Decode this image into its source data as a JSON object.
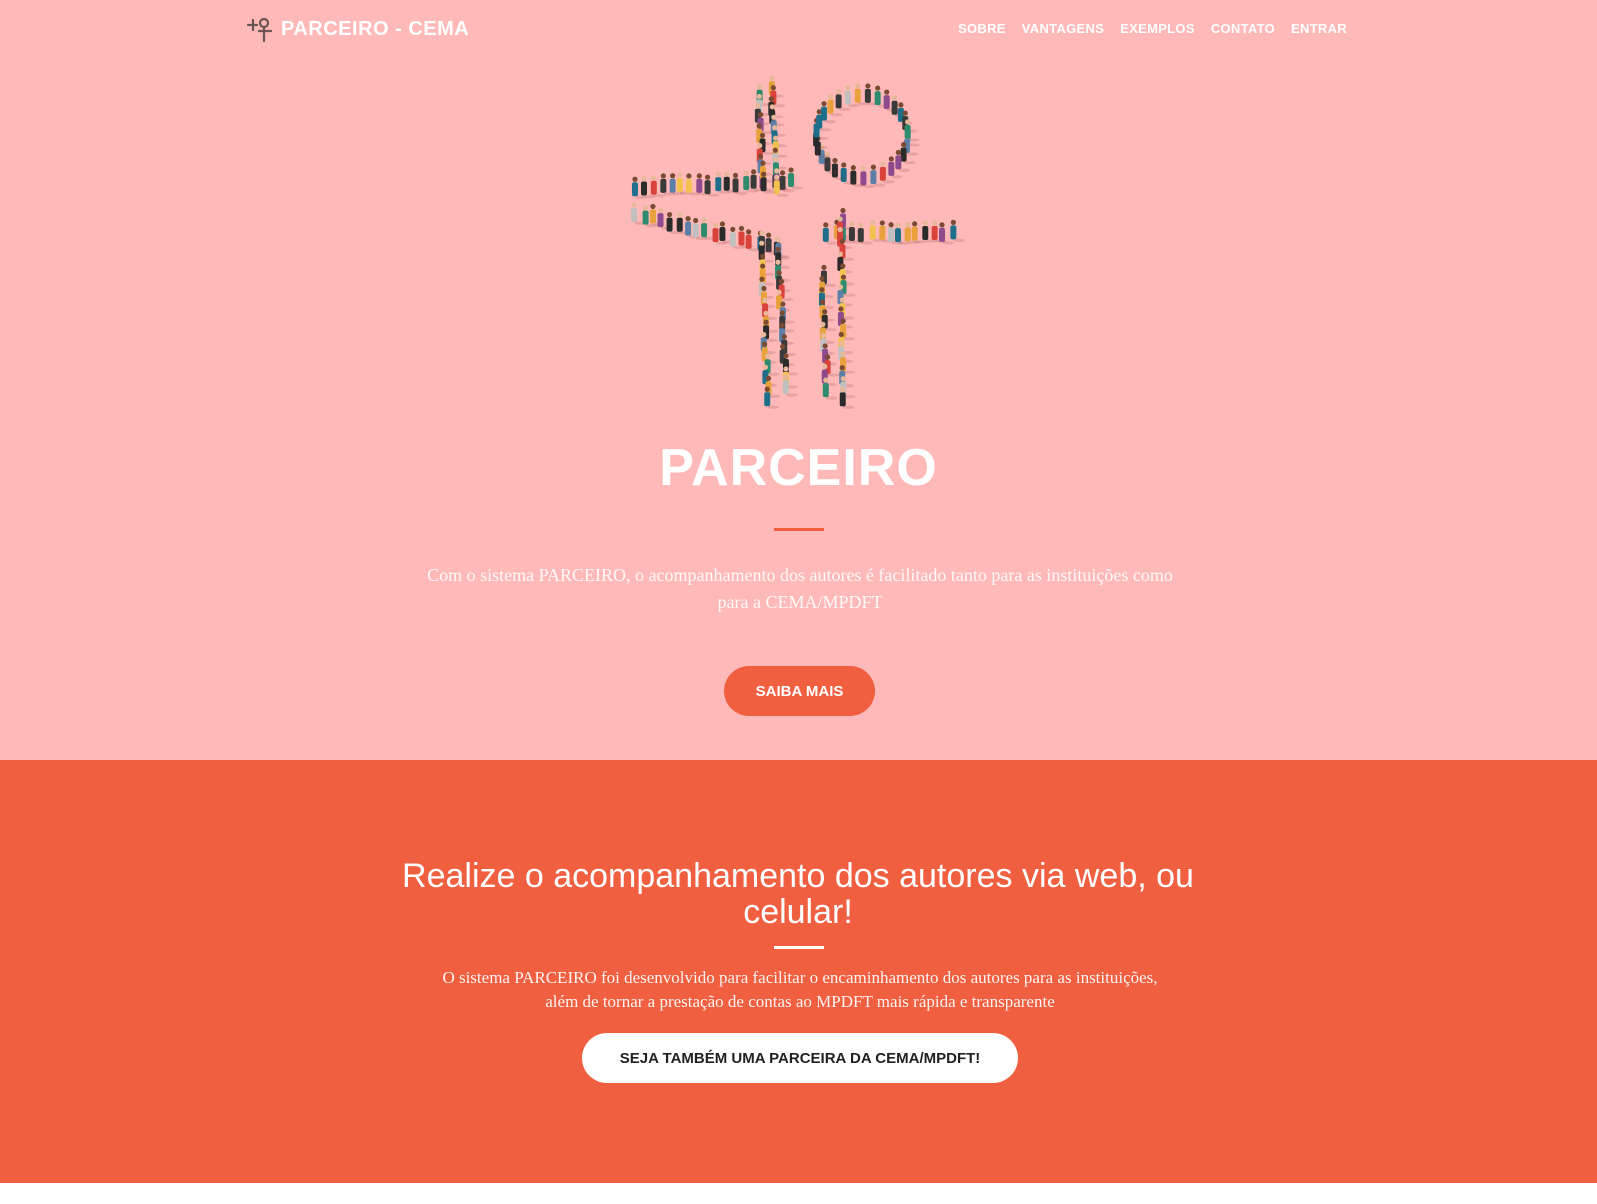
{
  "navbar": {
    "brand": "PARCEIRO - CEMA",
    "brand_icon": "plus-people-logo-icon",
    "links": [
      {
        "label": "SOBRE"
      },
      {
        "label": "VANTAGENS"
      },
      {
        "label": "EXEMPLOS"
      },
      {
        "label": "CONTATO"
      },
      {
        "label": "ENTRAR"
      }
    ]
  },
  "hero": {
    "graphic_icon": "crowd-forming-plus-signs-illustration",
    "title": "PARCEIRO",
    "text": "Com o sistema PARCEIRO, o acompanhamento dos autores é facilitado tanto para as instituições como para a CEMA/MPDFT",
    "button_label": "SAIBA MAIS"
  },
  "band": {
    "title": "Realize o acompanhamento dos autores via web, ou celular!",
    "text": "O sistema PARCEIRO foi desenvolvido para facilitar o encaminhamento dos autores para as instituições, além de tornar a prestação de contas ao MPDFT mais rápida e transparente",
    "button_label": "SEJA TAMBÉM UMA PARCEIRA DA CEMA/MPDFT!"
  },
  "colors": {
    "hero_bg": "#ffb9b8",
    "accent": "#f05f40",
    "white": "#ffffff",
    "dark_text": "#222222"
  }
}
